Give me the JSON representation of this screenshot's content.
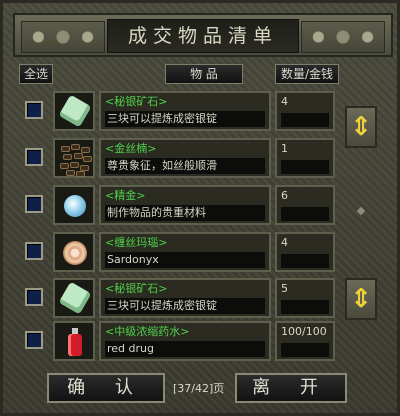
{
  "title": "成交物品清单",
  "header": {
    "select_all": "全选",
    "items_col": "物 品",
    "qty_col": "数量/金钱"
  },
  "items": [
    {
      "name": "<秘银矿石>",
      "desc": "三块可以提炼成密银锭",
      "qty": "4",
      "icon": "mithril-ore-icon"
    },
    {
      "name": "<金丝楠>",
      "desc": "尊贵象征，如丝般顺滑",
      "qty": "1",
      "icon": "gold-silk-wood-icon"
    },
    {
      "name": "<精金>",
      "desc": "制作物品的贵重材料",
      "qty": "6",
      "icon": "adamantite-icon"
    },
    {
      "name": "<缠丝玛瑙>",
      "desc": "Sardonyx",
      "qty": "4",
      "icon": "sardonyx-icon"
    },
    {
      "name": "<秘银矿石>",
      "desc": "三块可以提炼成密银锭",
      "qty": "5",
      "icon": "mithril-ore-icon"
    },
    {
      "name": "<中级浓缩药水>",
      "desc": "red drug",
      "qty": "100/100",
      "icon": "red-potion-icon"
    }
  ],
  "footer": {
    "confirm": "确 认",
    "page_info": "[37/42]页",
    "leave": "离 开"
  }
}
